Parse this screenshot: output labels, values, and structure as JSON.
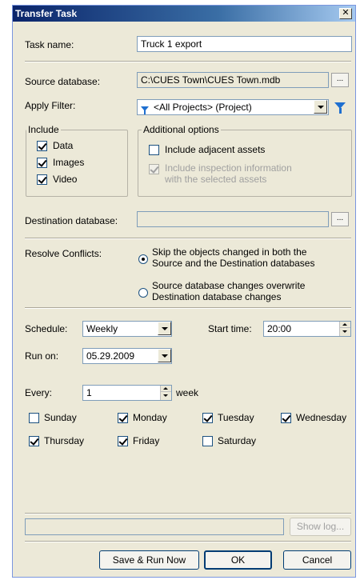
{
  "window": {
    "title": "Transfer Task",
    "close_glyph": "✕"
  },
  "task_name": {
    "label": "Task name:",
    "value": "Truck 1 export"
  },
  "source_db": {
    "label": "Source database:",
    "value": "C:\\CUES Town\\CUES Town.mdb",
    "browse": "..."
  },
  "filter": {
    "label": "Apply Filter:",
    "value": "<All Projects> (Project)",
    "icon": "filter-icon"
  },
  "include": {
    "title": "Include",
    "items": [
      {
        "label": "Data",
        "checked": true
      },
      {
        "label": "Images",
        "checked": true
      },
      {
        "label": "Video",
        "checked": true
      }
    ]
  },
  "additional": {
    "title": "Additional options",
    "adjacent_label": "Include adjacent assets",
    "inspection_line1": "Include inspection information",
    "inspection_line2": "with the selected assets"
  },
  "dest_db": {
    "label": "Destination database:",
    "value": "",
    "browse": "..."
  },
  "resolve": {
    "label": "Resolve Conflicts:",
    "option1_line1": "Skip the objects changed in both the",
    "option1_line2": "Source and the Destination databases",
    "option2_line1": "Source database changes overwrite",
    "option2_line2": "Destination database changes"
  },
  "schedule": {
    "label": "Schedule:",
    "value": "Weekly"
  },
  "start_time": {
    "label": "Start time:",
    "value": "20:00"
  },
  "run_on": {
    "label": "Run on:",
    "value": "05.29.2009"
  },
  "every": {
    "label": "Every:",
    "value": "1",
    "unit": "week"
  },
  "days": [
    {
      "label": "Sunday",
      "checked": false
    },
    {
      "label": "Monday",
      "checked": true
    },
    {
      "label": "Tuesday",
      "checked": true
    },
    {
      "label": "Wednesday",
      "checked": true
    },
    {
      "label": "Thursday",
      "checked": true
    },
    {
      "label": "Friday",
      "checked": true
    },
    {
      "label": "Saturday",
      "checked": false
    }
  ],
  "log": {
    "value": "",
    "show_log": "Show log..."
  },
  "buttons": {
    "save_run": "Save & Run Now",
    "ok": "OK",
    "cancel": "Cancel"
  }
}
